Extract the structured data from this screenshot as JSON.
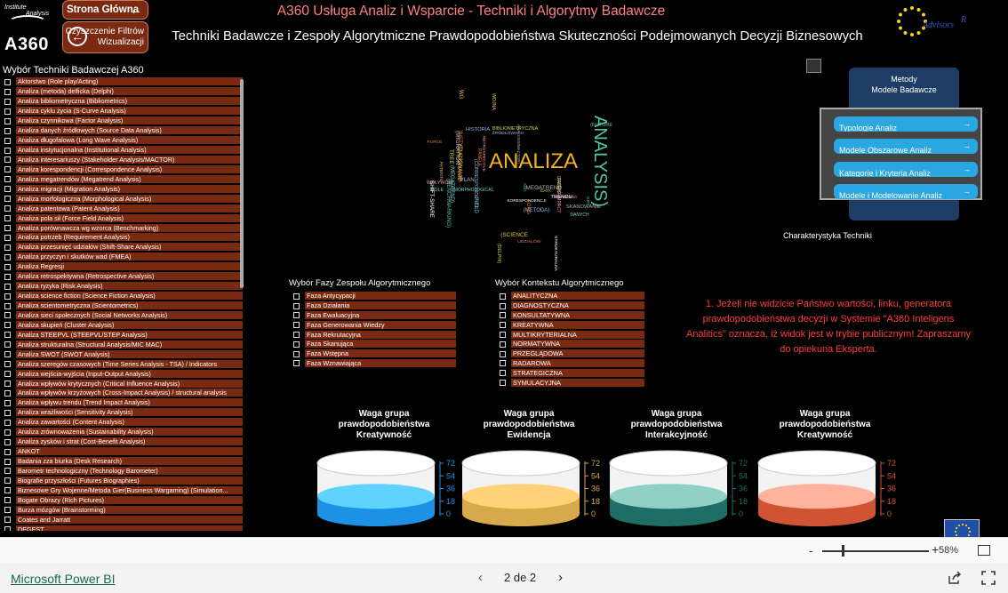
{
  "logo": {
    "institute": "Institute",
    "analysis": "Analysis",
    "brand": "A360"
  },
  "nav": {
    "home_label": "Strona Główna",
    "clear_label_1": "Czyszczenie Filtrów",
    "clear_label_2": "Wizualizacji"
  },
  "header": {
    "title": "A360 Usługa Analiz i Wsparcie - Techniki i Algorytmy Badawcze",
    "subtitle": "Techniki Badawcze i Zespoły Algorytmiczne Prawdopodobieństwa Skuteczności Podejmowanych Decyzji Biznesowych",
    "eu_logo_text": "Advisors"
  },
  "tech_selector": {
    "title": "Wybór Techniki Badawczej A360",
    "items": [
      "Aktorstwo (Role play/Acting)",
      "Analiza (metoda) delficka (Delphi)",
      "Analiza bibliometryczna (Bibliometrics)",
      "Analiza cyklu życia (S-Curve Analysis)",
      "Analiza czynnikowa (Factor Analysis)",
      "Analiza danych źródłowych (Source Data Analysis)",
      "Analiza długofalowa (Long Wave Analysis)",
      "Analiza instytucjonalna (Institutional Analysis)",
      "Analiza interesariuszy (Stakeholder Analysis/MACTOR)",
      "Analiza korespondencji (Correspondence Analysis)",
      "Analiza megatrendów (Megatrend Analysis)",
      "Analiza migracji (Migration Analysis)",
      "Analiza morfologiczna (Morphological Analysis)",
      "Analiza patentowa (Patent Analysis)",
      "Analiza pola sił (Force Field Analysis)",
      "Analiza porównawcza wg wzorca (Benchmarking)",
      "Analiza potrzeb (Requirement Analysis)",
      "Analiza przesunięć udziałów (Shift-Share Analysis)",
      "Analiza przyczyn i skutków wad (FMEA)",
      "Analiza Regresji",
      "Analiza retrospektywna (Retrospective Analysis)",
      "Analiza ryzyka (Risk Analysis)",
      "Analiza science fiction (Science Fiction Analysis)",
      "Analiza scientometryczna (Scientometrics)",
      "Analiza sieci społecznych (Social Networks Analysis)",
      "Analiza skupień (Cluster Analysis)",
      "Analiza STEEPVL (STEEPVL/STEP Analysis)",
      "Analiza strukturalna (Structural Analysis/MIC MAC)",
      "Analiza SWOT (SWOT Analysis)",
      "Analiza szeregów czasowych (Time Series Analysis - TSA) / Indicators",
      "Analiza wejścia-wyjścia (Input-Output Analysis)",
      "Analiza wpływów krytycznych (Critical Influence Analysis)",
      "Analiza wpływów krzyżowych (Cross-Impact Analysis) / structural analysis",
      "Analiza wpływu trendu (Trend Impact Analysis)",
      "Analiza wrażliwości (Sensitivity Analysis)",
      "Analiza zawartości (Content Analysis)",
      "Analiza zrównoważenia (Sustainability Analysis)",
      "Analiza zysków i strat (Cost-Benefit Analysis)",
      "ANKOT",
      "Badania zza biurka (Desk Research)",
      "Barometr technologiczny (Technology Barometer)",
      "Biografie przyszłości (Futures Biographies)",
      "Biznesowe Gry Wojenne/Metoda Gier(Business Wargaming) (Simulation...",
      "Bogate Obrazy (Rich Pictures)",
      "Burza mózgów (Brainstorming)",
      "Coates and Jarratt",
      "DEGEST"
    ]
  },
  "wordcloud": {
    "main_word": "ANALIZA",
    "second_word": "ANALYSIS)",
    "words": [
      "PATENTU",
      "(BENCHMARKING)",
      "INSTYTUCJONALNA",
      "ŹRÓDŁOWYCH",
      "BIBLIOMETRYCZNA",
      "MEGATREND",
      "SCANNING",
      "(MORPHOLOGICAL",
      "STRUKTURALNA",
      "SZACOWANIE",
      "FIELD",
      "UDZIAŁÓW",
      "HISTORIA",
      "DATA",
      "SKANOWANIE",
      "CROSS-IMPACT",
      "ROLE",
      "KORESPONDENCJI",
      "(SCIENCE",
      "(FUTURE",
      "PANELE",
      "(METODA)",
      "(DELPHI)",
      "(MIGRATION",
      "WPŁYWÓW",
      "DANYCH",
      "TRENDU",
      "WG",
      "AND",
      "FORCE",
      "(CORRESPONDENCE",
      "PATENT",
      "ANALYSIS/MACTOR)",
      "RETROSPECTIVE",
      "(MEGATREND)",
      "SHIFT-SHARE",
      "WOJNA",
      "GRY",
      "LONG",
      "PLAN",
      "TREE"
    ]
  },
  "methods": {
    "title_1": "Metody",
    "title_2": "Modele Badawcze",
    "buttons": [
      "Typologie Analiz",
      "Modele Obszarowe Analiz",
      "Kategorie i Kryteria Analiz",
      "Modele i Modelowanie Analiz"
    ],
    "characteristic_label": "Charakterystyka Techniki"
  },
  "phase_selector": {
    "title": "Wybór Fazy Zespołu Algorytmicznego",
    "items": [
      "Faza Antycypacji",
      "Faza Działania",
      "Faza Ewaluacyjna",
      "Faza Generowania Wiedzy",
      "Faza Rekrutacyjna",
      "Faza Skanująca",
      "Faza Wstępna",
      "Faza Wznawiająca"
    ]
  },
  "context_selector": {
    "title": "Wybór Kontekstu Algorytmicznego",
    "items": [
      "ANALITYCZNA",
      "DIAGNOSTYCZNA",
      "KONSULTATYWNA",
      "KREATYWNA",
      "MULTIKRYTERIALNA",
      "NORMATYWNA",
      "PRZEGLĄDOWA",
      "RADAROWA",
      "STRATEGICZNA",
      "SYMULACYJNA"
    ]
  },
  "notice": {
    "text": "1. Jeżeli nie widzicie Państwo wartości, linku, generatora prawdopodobieństwa decyzji w Systemie \"A360 Inteligens Analitics\" oznacza, iż widok jest w trybie publicznym! Zapraszamy do opiekuna Eksperta."
  },
  "gauges": [
    {
      "title": "Waga grupa prawdopodobieństwa Kreatywność",
      "color": "#1e90e6",
      "light": "#5fd2ff",
      "ticks": [
        "72",
        "54",
        "36",
        "18",
        "0"
      ],
      "value": 25
    },
    {
      "title": "Waga grupa prawdopodobieństwa Ewidencja",
      "color": "#d6a94a",
      "light": "#ffd27a",
      "ticks": [
        "72",
        "54",
        "36",
        "18",
        "0"
      ],
      "value": 25
    },
    {
      "title": "Waga grupa prawdopodobieństwa Interakcyjność",
      "color": "#1f6e66",
      "light": "#8fcfc4",
      "ticks": [
        "72",
        "54",
        "36",
        "18",
        "0"
      ],
      "value": 25
    },
    {
      "title": "Waga grupa prawdopodobieństwa Kreatywność",
      "color": "#d05434",
      "light": "#ffb39c",
      "ticks": [
        "72",
        "54",
        "36",
        "18",
        "0"
      ],
      "value": 25
    }
  ],
  "footer": {
    "zoom_minus": "-",
    "zoom_plus": "+",
    "zoom_level": "58%",
    "pbi_label": "Microsoft Power BI",
    "page_indicator": "2 de 2",
    "prev": "‹",
    "next": "›"
  }
}
